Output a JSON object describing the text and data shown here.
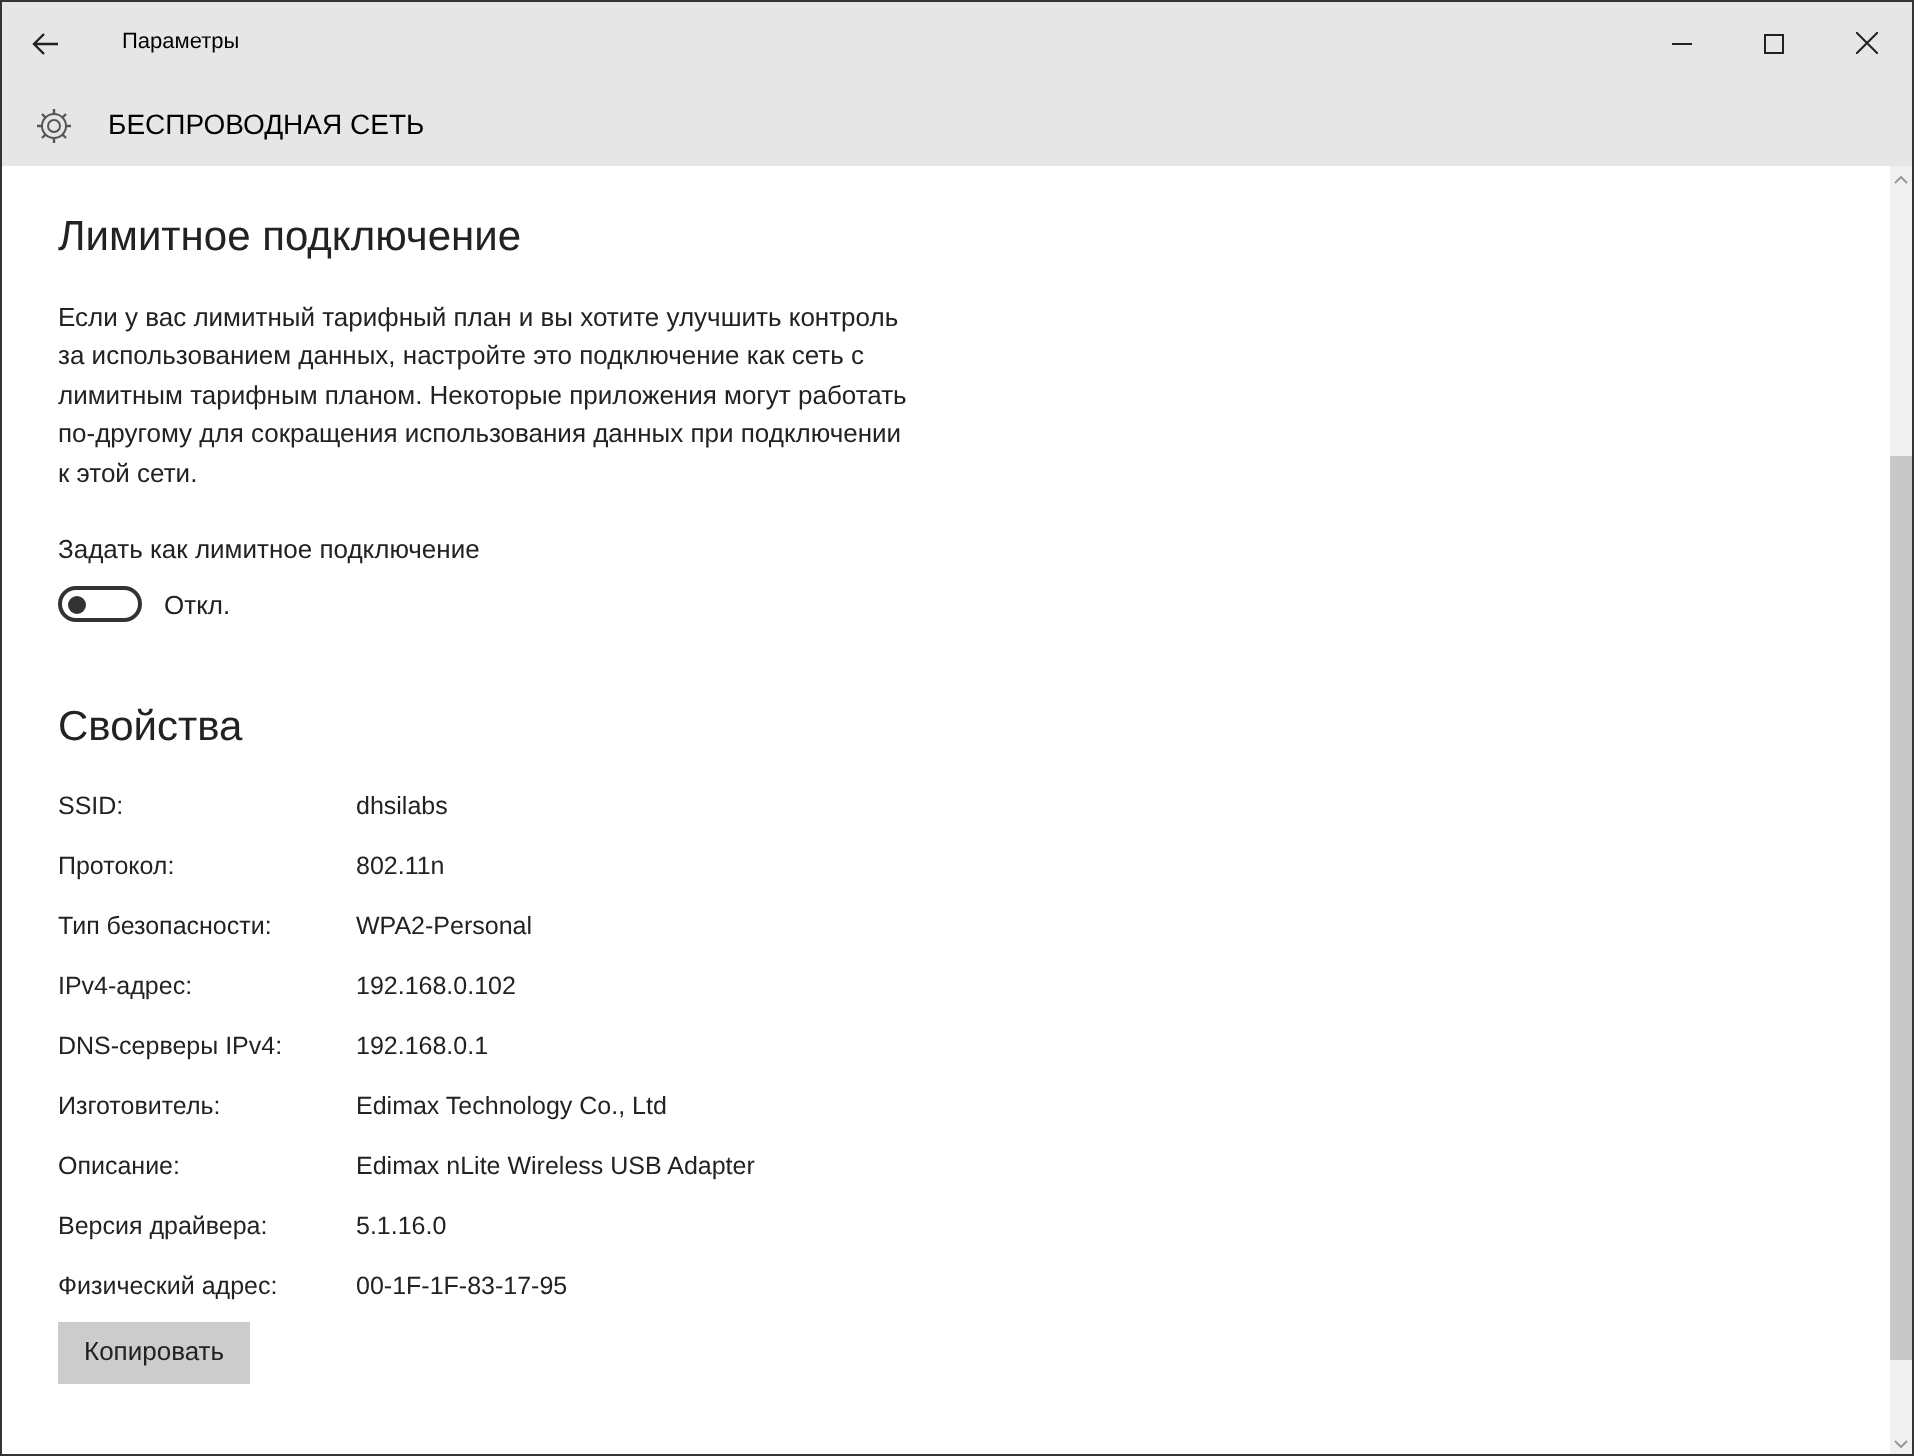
{
  "window": {
    "title": "Параметры"
  },
  "header": {
    "title": "БЕСПРОВОДНАЯ СЕТЬ"
  },
  "metered": {
    "heading": "Лимитное подключение",
    "description": "Если у вас лимитный тарифный план и вы хотите улучшить контроль за использованием данных, настройте это подключение как сеть с лимитным тарифным планом. Некоторые приложения могут работать по-другому для сокращения использования данных при подключении к этой сети.",
    "toggle_label": "Задать как лимитное подключение",
    "toggle": {
      "on": false,
      "state_text": "Откл."
    }
  },
  "properties": {
    "heading": "Свойства",
    "rows": [
      {
        "label": "SSID:",
        "value": "dhsilabs"
      },
      {
        "label": "Протокол:",
        "value": "802.11n"
      },
      {
        "label": "Тип безопасности:",
        "value": "WPA2-Personal"
      },
      {
        "label": "IPv4-адрес:",
        "value": "192.168.0.102"
      },
      {
        "label": "DNS-серверы IPv4:",
        "value": "192.168.0.1"
      },
      {
        "label": "Изготовитель:",
        "value": "Edimax Technology Co., Ltd"
      },
      {
        "label": "Описание:",
        "value": "Edimax nLite Wireless USB Adapter"
      },
      {
        "label": "Версия драйвера:",
        "value": "5.1.16.0"
      },
      {
        "label": "Физический адрес:",
        "value": "00-1F-1F-83-17-95"
      }
    ],
    "copy_button": "Копировать"
  }
}
